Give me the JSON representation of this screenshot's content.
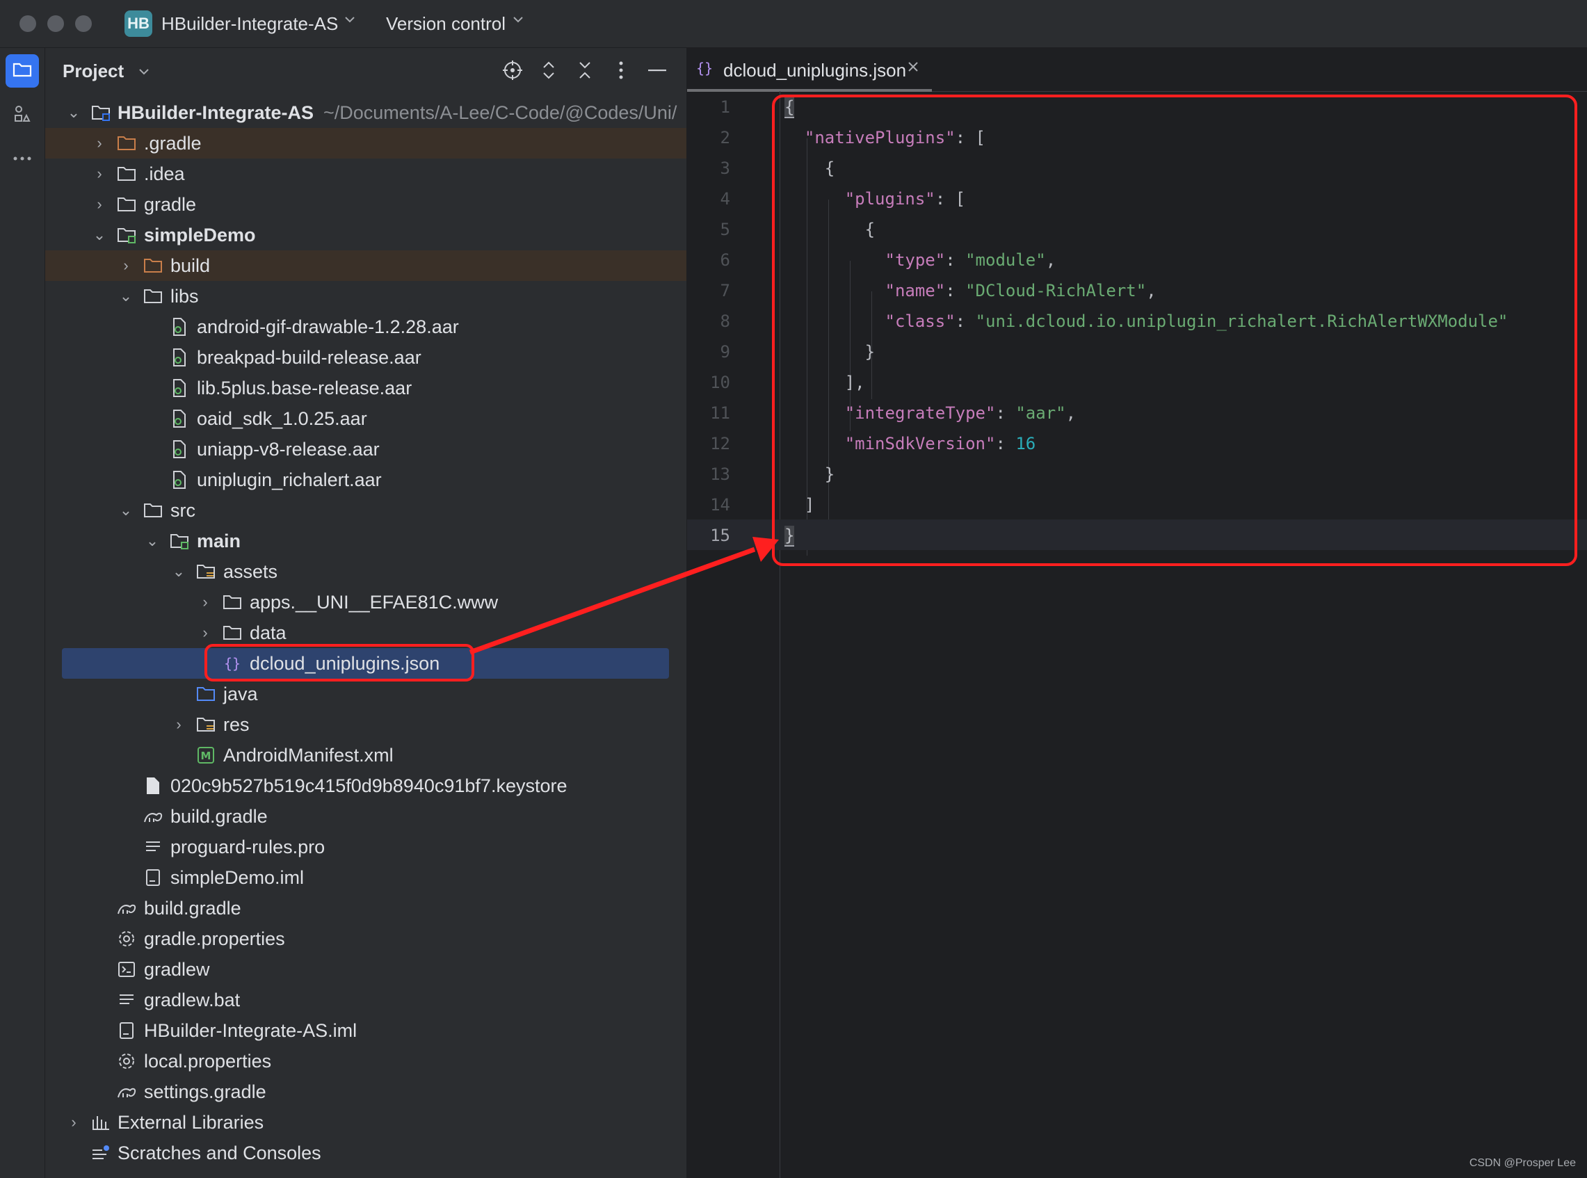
{
  "titlebar": {
    "project_badge": "HB",
    "project_name": "HBuilder-Integrate-AS",
    "vcs_label": "Version control"
  },
  "panel": {
    "title": "Project"
  },
  "tree": [
    {
      "label": "HBuilder-Integrate-AS",
      "path": "~/Documents/A-Lee/C-Code/@Codes/Uni/",
      "bold": true
    },
    {
      "label": ".gradle"
    },
    {
      "label": ".idea"
    },
    {
      "label": "gradle"
    },
    {
      "label": "simpleDemo",
      "bold": true
    },
    {
      "label": "build"
    },
    {
      "label": "libs"
    },
    {
      "label": "android-gif-drawable-1.2.28.aar"
    },
    {
      "label": "breakpad-build-release.aar"
    },
    {
      "label": "lib.5plus.base-release.aar"
    },
    {
      "label": "oaid_sdk_1.0.25.aar"
    },
    {
      "label": "uniapp-v8-release.aar"
    },
    {
      "label": "uniplugin_richalert.aar"
    },
    {
      "label": "src"
    },
    {
      "label": "main",
      "bold": true
    },
    {
      "label": "assets"
    },
    {
      "label": "apps.__UNI__EFAE81C.www"
    },
    {
      "label": "data"
    },
    {
      "label": "dcloud_uniplugins.json"
    },
    {
      "label": "java"
    },
    {
      "label": "res"
    },
    {
      "label": "AndroidManifest.xml"
    },
    {
      "label": "020c9b527b519c415f0d9b8940c91bf7.keystore"
    },
    {
      "label": "build.gradle"
    },
    {
      "label": "proguard-rules.pro"
    },
    {
      "label": "simpleDemo.iml"
    },
    {
      "label": "build.gradle"
    },
    {
      "label": "gradle.properties"
    },
    {
      "label": "gradlew"
    },
    {
      "label": "gradlew.bat"
    },
    {
      "label": "HBuilder-Integrate-AS.iml"
    },
    {
      "label": "local.properties"
    },
    {
      "label": "settings.gradle"
    },
    {
      "label": "External Libraries"
    },
    {
      "label": "Scratches and Consoles"
    }
  ],
  "editor": {
    "tab_label": "dcloud_uniplugins.json",
    "line_numbers": [
      "1",
      "2",
      "3",
      "4",
      "5",
      "6",
      "7",
      "8",
      "9",
      "10",
      "11",
      "12",
      "13",
      "14",
      "15"
    ],
    "code": {
      "l1": "{",
      "native_plugins_key": "\"nativePlugins\"",
      "plugins_key": "\"plugins\"",
      "type_key": "\"type\"",
      "type_val": "\"module\"",
      "name_key": "\"name\"",
      "name_val": "\"DCloud-RichAlert\"",
      "class_key": "\"class\"",
      "class_val": "\"uni.dcloud.io.uniplugin_richalert.RichAlertWXModule\"",
      "integrate_key": "\"integrateType\"",
      "integrate_val": "\"aar\"",
      "minsdk_key": "\"minSdkVersion\"",
      "minsdk_val": "16"
    }
  },
  "watermark": "CSDN @Prosper Lee",
  "colors": {
    "annotation_red": "#ff1f1f",
    "selection": "#2e436e",
    "json_key": "#c77dbb",
    "json_string": "#6aab73",
    "json_number": "#2aacb8"
  }
}
